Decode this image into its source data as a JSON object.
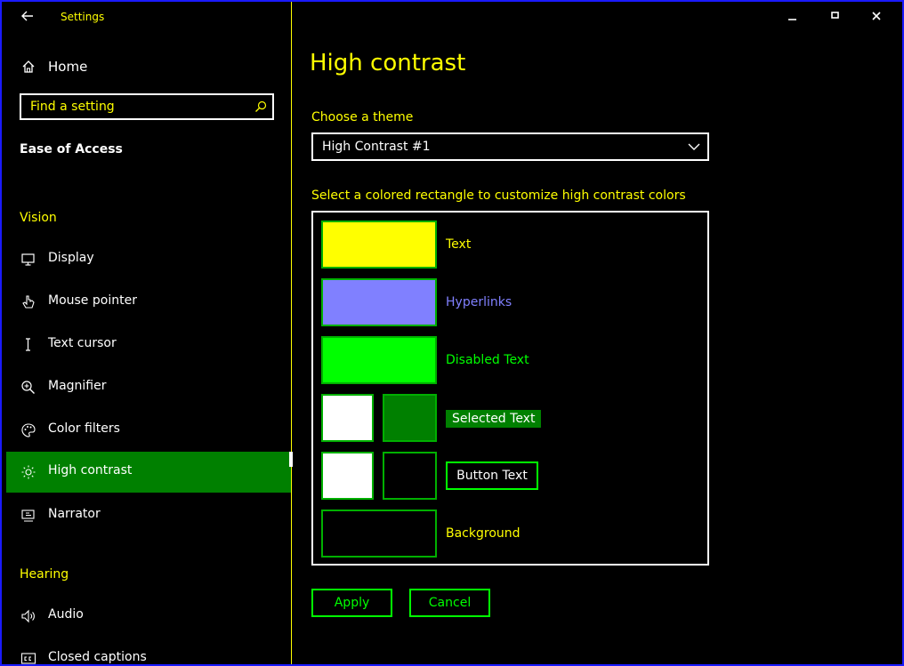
{
  "window": {
    "title": "Settings",
    "accent_border": "#1a1aff",
    "controls": [
      "minimize",
      "maximize",
      "close"
    ]
  },
  "sidebar": {
    "home_label": "Home",
    "search_placeholder": "Find a setting",
    "section": "Ease of Access",
    "groups": [
      {
        "title": "Vision",
        "items": [
          {
            "label": "Display",
            "icon": "display-icon"
          },
          {
            "label": "Mouse pointer",
            "icon": "mouse-pointer-icon"
          },
          {
            "label": "Text cursor",
            "icon": "text-cursor-icon"
          },
          {
            "label": "Magnifier",
            "icon": "magnifier-icon"
          },
          {
            "label": "Color filters",
            "icon": "color-filters-icon"
          },
          {
            "label": "High contrast",
            "icon": "high-contrast-icon",
            "active": true
          },
          {
            "label": "Narrator",
            "icon": "narrator-icon"
          }
        ]
      },
      {
        "title": "Hearing",
        "items": [
          {
            "label": "Audio",
            "icon": "audio-icon"
          },
          {
            "label": "Closed captions",
            "icon": "closed-captions-icon"
          }
        ]
      }
    ]
  },
  "main": {
    "title": "High contrast",
    "theme_label": "Choose a theme",
    "theme_value": "High Contrast #1",
    "customize_label": "Select a colored rectangle to customize high contrast colors",
    "colors": {
      "text": {
        "label": "Text",
        "color": "#ffff00"
      },
      "hyperlinks": {
        "label": "Hyperlinks",
        "color": "#8080ff"
      },
      "disabled_text": {
        "label": "Disabled Text",
        "color": "#00ff00"
      },
      "selected_text": {
        "label": "Selected Text",
        "foreground": "#ffffff",
        "background": "#008000"
      },
      "button_text": {
        "label": "Button Text",
        "foreground": "#ffffff",
        "background": "#000000"
      },
      "background": {
        "label": "Background",
        "color": "#000000"
      }
    },
    "apply_label": "Apply",
    "cancel_label": "Cancel"
  }
}
